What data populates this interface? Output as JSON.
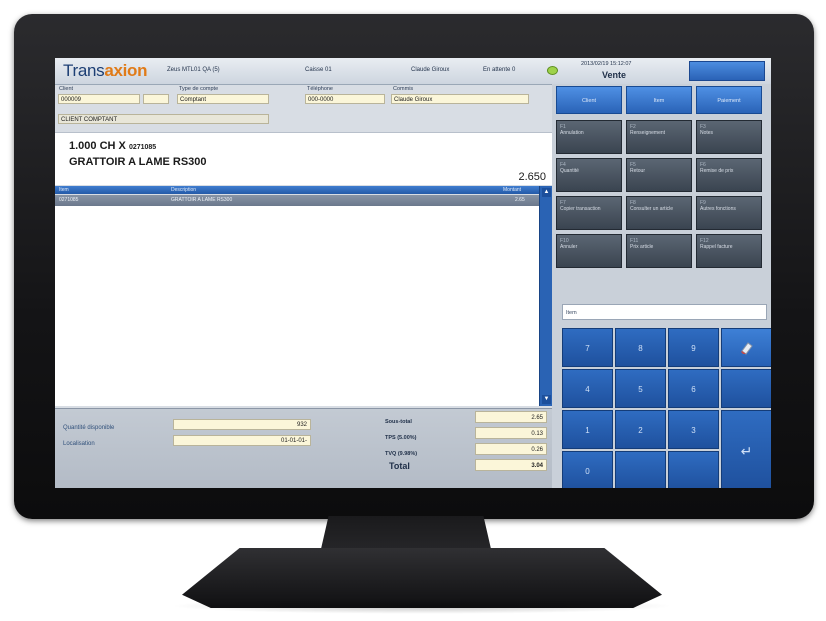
{
  "app": {
    "logo_prefix": "Trans",
    "logo_accent": "axion"
  },
  "topbar": {
    "store": "Zeus MTL01 QA (5)",
    "register": "Caisse 01",
    "user": "Claude Giroux",
    "pending": "En attente 0",
    "datetime": "2013/02/19 15:12:07",
    "mode": "Vente",
    "status_color": "#9ed24a"
  },
  "form": {
    "client_label": "Client",
    "client_value": "000009",
    "type_label": "Type de compte",
    "type_value": "Comptant",
    "phone_label": "Téléphone",
    "phone_value": "000-0000",
    "clerk_label": "Commis",
    "clerk_value": "Claude Giroux",
    "client_name": "CLIENT COMPTANT"
  },
  "item_display": {
    "qty_line": "1.000 CH X",
    "item_code": "0271085",
    "description": "GRATTOIR A LAME RS300",
    "price": "2.650"
  },
  "grid": {
    "headers": [
      "Item",
      "Description",
      "Montant"
    ],
    "rows": [
      {
        "item": "0271085",
        "description": "GRATTOIR A LAME RS300",
        "amount": "2.65"
      }
    ]
  },
  "bottom": {
    "qty_label": "Quantité disponible",
    "qty_value": "932",
    "location_label": "Localisation",
    "location_value": "01-01-01-",
    "subtotal_label": "Sous-total",
    "subtotal_value": "2.65",
    "tps_label": "TPS (5.00%)",
    "tps_value": "0.13",
    "tvq_label": "TVQ (9.98%)",
    "tvq_value": "0.26",
    "total_label": "Total",
    "total_value": "3.04"
  },
  "right_panel": {
    "top_buttons": [
      "Client",
      "Item",
      "Paiement"
    ],
    "function_keys": [
      {
        "fk": "F1",
        "label": "Annulation"
      },
      {
        "fk": "F2",
        "label": "Renseignement"
      },
      {
        "fk": "F3",
        "label": "Notes"
      },
      {
        "fk": "F4",
        "label": "Quantité"
      },
      {
        "fk": "F5",
        "label": "Retour"
      },
      {
        "fk": "F6",
        "label": "Remise de prix"
      },
      {
        "fk": "F7",
        "label": "Copier transaction"
      },
      {
        "fk": "F8",
        "label": "Consulter un article"
      },
      {
        "fk": "F9",
        "label": "Autres fonctions"
      },
      {
        "fk": "F10",
        "label": "Annuler"
      },
      {
        "fk": "F11",
        "label": "Prix article"
      },
      {
        "fk": "F12",
        "label": "Rappel facture"
      }
    ],
    "note_value": "Item",
    "keypad": [
      "7",
      "8",
      "9",
      "4",
      "5",
      "6",
      "1",
      "2",
      "3",
      "0",
      "",
      ""
    ],
    "enter_symbol": "↵"
  }
}
